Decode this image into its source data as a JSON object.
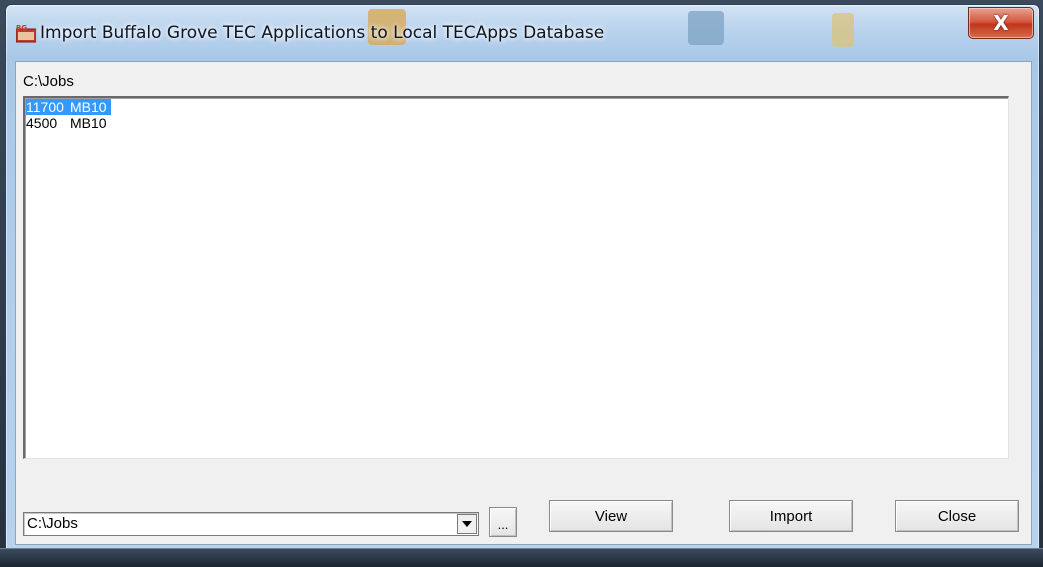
{
  "window": {
    "title": "Import Buffalo Grove TEC Applications to Local TECApps Database",
    "icon": "bg-app-icon",
    "close_glyph": "X"
  },
  "main": {
    "path_label": "C:\\Jobs",
    "jobs": [
      {
        "number": "11700",
        "model": "MB10",
        "selected": true
      },
      {
        "number": "4500",
        "model": "MB10",
        "selected": false
      }
    ]
  },
  "footer": {
    "path_value": "C:\\Jobs",
    "browse_label": "...",
    "view_label": "View",
    "import_label": "Import",
    "close_label": "Close"
  },
  "colors": {
    "selection": "#3399ff",
    "window_frame": "#a9c8e8",
    "close_button": "#c2351b",
    "dialog_background": "#f0f0f0"
  }
}
